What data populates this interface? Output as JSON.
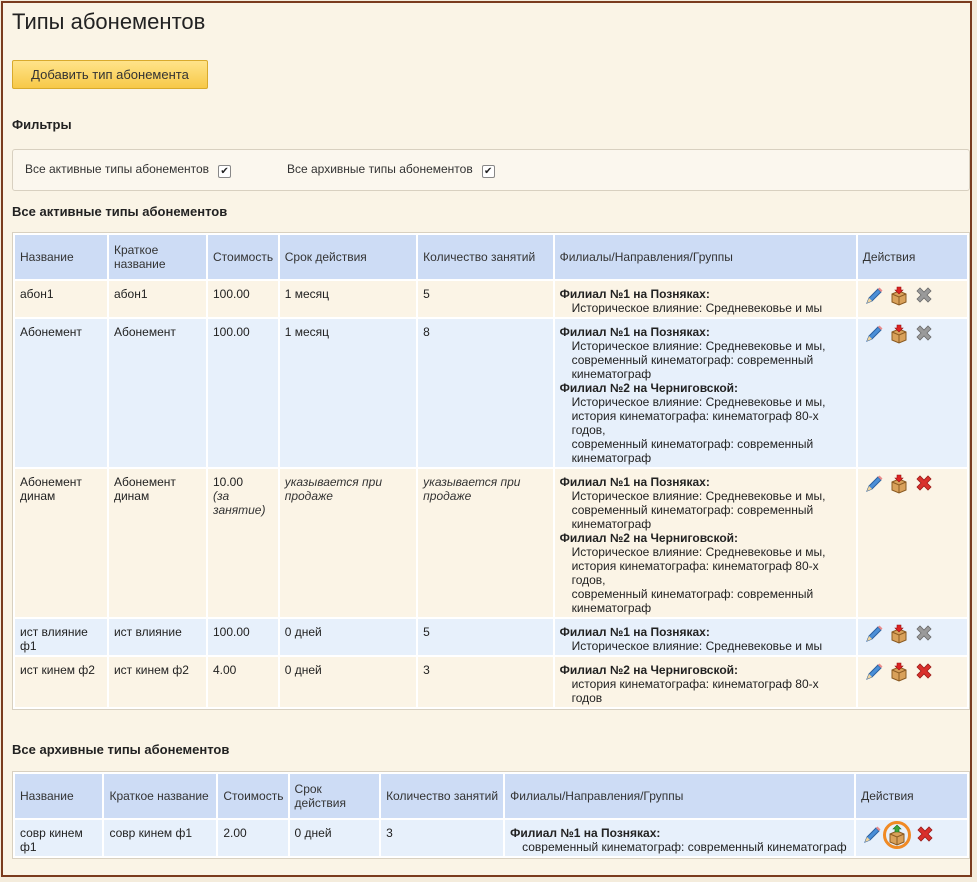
{
  "page": {
    "title": "Типы абонементов",
    "add_button": "Добавить тип абонемента"
  },
  "filters": {
    "title": "Фильтры",
    "items": [
      {
        "label": "Все активные типы абонементов",
        "checked": true
      },
      {
        "label": "Все архивные типы абонементов",
        "checked": true
      }
    ]
  },
  "active": {
    "title": "Все активные типы абонементов",
    "columns": [
      "Название",
      "Краткое название",
      "Стоимость",
      "Срок действия",
      "Количество занятий",
      "Филиалы/Направления/Группы",
      "Действия"
    ],
    "rows": [
      {
        "name": "абон1",
        "short": "абон1",
        "price": "100.00",
        "price_note": "",
        "term": "1 месяц",
        "term_italic": false,
        "count": "5",
        "count_italic": false,
        "branches": [
          {
            "name": "Филиал №1 на Позняках",
            "dirs": [
              "Историческое влияние: Средневековье и мы"
            ]
          }
        ],
        "delete_enabled": false
      },
      {
        "name": "Абонемент",
        "short": "Абонемент",
        "price": "100.00",
        "price_note": "",
        "term": "1 месяц",
        "term_italic": false,
        "count": "8",
        "count_italic": false,
        "branches": [
          {
            "name": "Филиал №1 на Позняках",
            "dirs": [
              "Историческое влияние: Средневековье и мы,",
              "современный кинематограф: современный кинематограф"
            ]
          },
          {
            "name": "Филиал №2 на Черниговской",
            "dirs": [
              "Историческое влияние: Средневековье и мы,",
              "история кинематографа: кинематограф 80-х годов,",
              "современный кинематограф: современный кинематограф"
            ]
          }
        ],
        "delete_enabled": false
      },
      {
        "name": "Абонемент динам",
        "short": "Абонемент динам",
        "price": "10.00",
        "price_note": "(за занятие)",
        "term": "указывается при продаже",
        "term_italic": true,
        "count": "указывается при продаже",
        "count_italic": true,
        "branches": [
          {
            "name": "Филиал №1 на Позняках",
            "dirs": [
              "Историческое влияние: Средневековье и мы,",
              "современный кинематограф: современный кинематограф"
            ]
          },
          {
            "name": "Филиал №2 на Черниговской",
            "dirs": [
              "Историческое влияние: Средневековье и мы,",
              "история кинематографа: кинематограф 80-х годов,",
              "современный кинематограф: современный кинематограф"
            ]
          }
        ],
        "delete_enabled": true
      },
      {
        "name": "ист влияние ф1",
        "short": "ист влияние",
        "price": "100.00",
        "price_note": "",
        "term": "0 дней",
        "term_italic": false,
        "count": "5",
        "count_italic": false,
        "branches": [
          {
            "name": "Филиал №1 на Позняках",
            "dirs": [
              "Историческое влияние: Средневековье и мы"
            ]
          }
        ],
        "delete_enabled": false
      },
      {
        "name": "ист кинем ф2",
        "short": "ист кинем ф2",
        "price": "4.00",
        "price_note": "",
        "term": "0 дней",
        "term_italic": false,
        "count": "3",
        "count_italic": false,
        "branches": [
          {
            "name": "Филиал №2 на Черниговской",
            "dirs": [
              "история кинематографа: кинематограф 80-х годов"
            ]
          }
        ],
        "delete_enabled": true
      }
    ]
  },
  "archive": {
    "title": "Все архивные типы абонементов",
    "columns": [
      "Название",
      "Краткое название",
      "Стоимость",
      "Срок действия",
      "Количество занятий",
      "Филиалы/Направления/Группы",
      "Действия"
    ],
    "rows": [
      {
        "name": "совр кинем ф1",
        "short": "совр кинем ф1",
        "price": "2.00",
        "term": "0 дней",
        "count": "3",
        "branches": [
          {
            "name": "Филиал №1 на Позняках",
            "dirs": [
              "современный кинематограф: современный кинематограф"
            ]
          }
        ],
        "delete_enabled": true,
        "highlight_restore": true
      }
    ]
  },
  "icons": {
    "edit": "pencil-icon",
    "archive": "archive-box-icon",
    "restore": "restore-box-icon",
    "delete": "delete-x-icon"
  },
  "colors": {
    "header_bg": "#cddcf5",
    "row_a": "#fbf4e6",
    "row_b": "#e7f0fb",
    "button": "#f7c948",
    "frame": "#7a3b1e",
    "highlight": "#f08a24"
  }
}
